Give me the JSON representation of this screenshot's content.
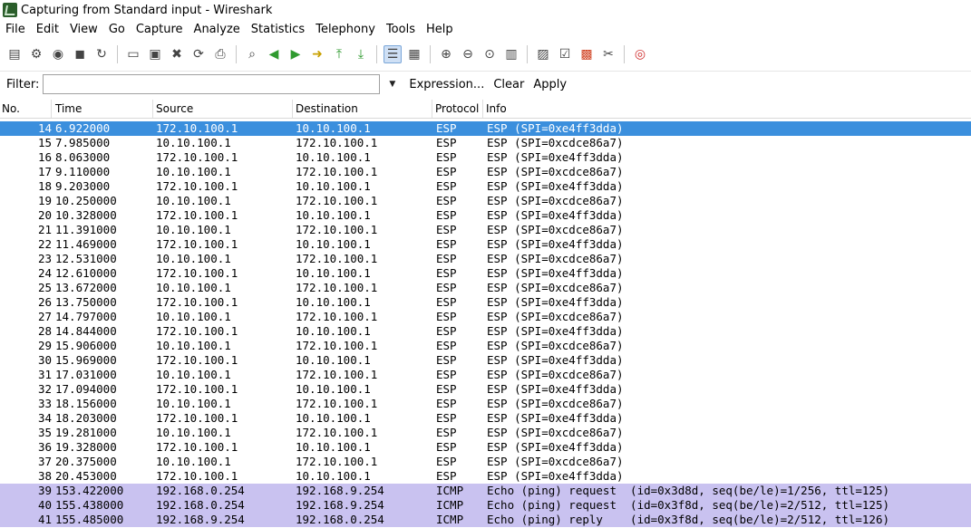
{
  "window": {
    "title": "Capturing from Standard input - Wireshark"
  },
  "menu": [
    "File",
    "Edit",
    "View",
    "Go",
    "Capture",
    "Analyze",
    "Statistics",
    "Telephony",
    "Tools",
    "Help"
  ],
  "toolbar": {
    "icons": [
      "interface-list-icon",
      "capture-options-icon",
      "start-capture-icon",
      "stop-capture-icon",
      "restart-capture-icon",
      "open-file-icon",
      "save-file-icon",
      "close-file-icon",
      "reload-icon",
      "print-icon",
      "find-packet-icon",
      "go-back-icon",
      "go-forward-icon",
      "go-to-packet-icon",
      "go-first-icon",
      "go-last-icon",
      "colorize-icon",
      "auto-scroll-icon",
      "zoom-in-icon",
      "zoom-out-icon",
      "normal-size-icon",
      "resize-columns-icon",
      "capture-filters-icon",
      "display-filters-icon",
      "coloring-rules-icon",
      "preferences-icon",
      "help-icon"
    ]
  },
  "filter": {
    "label": "Filter:",
    "value": "",
    "expression": "Expression...",
    "clear": "Clear",
    "apply": "Apply"
  },
  "columns": [
    "No.",
    "Time",
    "Source",
    "Destination",
    "Protocol",
    "Info"
  ],
  "packets": [
    {
      "no": "14",
      "time": "6.922000",
      "src": "172.10.100.1",
      "dst": "10.10.100.1",
      "proto": "ESP",
      "info": "ESP (SPI=0xe4ff3dda)"
    },
    {
      "no": "15",
      "time": "7.985000",
      "src": "10.10.100.1",
      "dst": "172.10.100.1",
      "proto": "ESP",
      "info": "ESP (SPI=0xcdce86a7)"
    },
    {
      "no": "16",
      "time": "8.063000",
      "src": "172.10.100.1",
      "dst": "10.10.100.1",
      "proto": "ESP",
      "info": "ESP (SPI=0xe4ff3dda)"
    },
    {
      "no": "17",
      "time": "9.110000",
      "src": "10.10.100.1",
      "dst": "172.10.100.1",
      "proto": "ESP",
      "info": "ESP (SPI=0xcdce86a7)"
    },
    {
      "no": "18",
      "time": "9.203000",
      "src": "172.10.100.1",
      "dst": "10.10.100.1",
      "proto": "ESP",
      "info": "ESP (SPI=0xe4ff3dda)"
    },
    {
      "no": "19",
      "time": "10.250000",
      "src": "10.10.100.1",
      "dst": "172.10.100.1",
      "proto": "ESP",
      "info": "ESP (SPI=0xcdce86a7)"
    },
    {
      "no": "20",
      "time": "10.328000",
      "src": "172.10.100.1",
      "dst": "10.10.100.1",
      "proto": "ESP",
      "info": "ESP (SPI=0xe4ff3dda)"
    },
    {
      "no": "21",
      "time": "11.391000",
      "src": "10.10.100.1",
      "dst": "172.10.100.1",
      "proto": "ESP",
      "info": "ESP (SPI=0xcdce86a7)"
    },
    {
      "no": "22",
      "time": "11.469000",
      "src": "172.10.100.1",
      "dst": "10.10.100.1",
      "proto": "ESP",
      "info": "ESP (SPI=0xe4ff3dda)"
    },
    {
      "no": "23",
      "time": "12.531000",
      "src": "10.10.100.1",
      "dst": "172.10.100.1",
      "proto": "ESP",
      "info": "ESP (SPI=0xcdce86a7)"
    },
    {
      "no": "24",
      "time": "12.610000",
      "src": "172.10.100.1",
      "dst": "10.10.100.1",
      "proto": "ESP",
      "info": "ESP (SPI=0xe4ff3dda)"
    },
    {
      "no": "25",
      "time": "13.672000",
      "src": "10.10.100.1",
      "dst": "172.10.100.1",
      "proto": "ESP",
      "info": "ESP (SPI=0xcdce86a7)"
    },
    {
      "no": "26",
      "time": "13.750000",
      "src": "172.10.100.1",
      "dst": "10.10.100.1",
      "proto": "ESP",
      "info": "ESP (SPI=0xe4ff3dda)"
    },
    {
      "no": "27",
      "time": "14.797000",
      "src": "10.10.100.1",
      "dst": "172.10.100.1",
      "proto": "ESP",
      "info": "ESP (SPI=0xcdce86a7)"
    },
    {
      "no": "28",
      "time": "14.844000",
      "src": "172.10.100.1",
      "dst": "10.10.100.1",
      "proto": "ESP",
      "info": "ESP (SPI=0xe4ff3dda)"
    },
    {
      "no": "29",
      "time": "15.906000",
      "src": "10.10.100.1",
      "dst": "172.10.100.1",
      "proto": "ESP",
      "info": "ESP (SPI=0xcdce86a7)"
    },
    {
      "no": "30",
      "time": "15.969000",
      "src": "172.10.100.1",
      "dst": "10.10.100.1",
      "proto": "ESP",
      "info": "ESP (SPI=0xe4ff3dda)"
    },
    {
      "no": "31",
      "time": "17.031000",
      "src": "10.10.100.1",
      "dst": "172.10.100.1",
      "proto": "ESP",
      "info": "ESP (SPI=0xcdce86a7)"
    },
    {
      "no": "32",
      "time": "17.094000",
      "src": "172.10.100.1",
      "dst": "10.10.100.1",
      "proto": "ESP",
      "info": "ESP (SPI=0xe4ff3dda)"
    },
    {
      "no": "33",
      "time": "18.156000",
      "src": "10.10.100.1",
      "dst": "172.10.100.1",
      "proto": "ESP",
      "info": "ESP (SPI=0xcdce86a7)"
    },
    {
      "no": "34",
      "time": "18.203000",
      "src": "172.10.100.1",
      "dst": "10.10.100.1",
      "proto": "ESP",
      "info": "ESP (SPI=0xe4ff3dda)"
    },
    {
      "no": "35",
      "time": "19.281000",
      "src": "10.10.100.1",
      "dst": "172.10.100.1",
      "proto": "ESP",
      "info": "ESP (SPI=0xcdce86a7)"
    },
    {
      "no": "36",
      "time": "19.328000",
      "src": "172.10.100.1",
      "dst": "10.10.100.1",
      "proto": "ESP",
      "info": "ESP (SPI=0xe4ff3dda)"
    },
    {
      "no": "37",
      "time": "20.375000",
      "src": "10.10.100.1",
      "dst": "172.10.100.1",
      "proto": "ESP",
      "info": "ESP (SPI=0xcdce86a7)"
    },
    {
      "no": "38",
      "time": "20.453000",
      "src": "172.10.100.1",
      "dst": "10.10.100.1",
      "proto": "ESP",
      "info": "ESP (SPI=0xe4ff3dda)"
    },
    {
      "no": "39",
      "time": "153.422000",
      "src": "192.168.0.254",
      "dst": "192.168.9.254",
      "proto": "ICMP",
      "info": "Echo (ping) request  (id=0x3d8d, seq(be/le)=1/256, ttl=125)"
    },
    {
      "no": "40",
      "time": "155.438000",
      "src": "192.168.0.254",
      "dst": "192.168.9.254",
      "proto": "ICMP",
      "info": "Echo (ping) request  (id=0x3f8d, seq(be/le)=2/512, ttl=125)"
    },
    {
      "no": "41",
      "time": "155.485000",
      "src": "192.168.9.254",
      "dst": "192.168.0.254",
      "proto": "ICMP",
      "info": "Echo (ping) reply    (id=0x3f8d, seq(be/le)=2/512, ttl=126)"
    }
  ],
  "selected_row": 0,
  "colors": {
    "selected": "#3b8fdd",
    "icmp": "#c9c2f0"
  }
}
